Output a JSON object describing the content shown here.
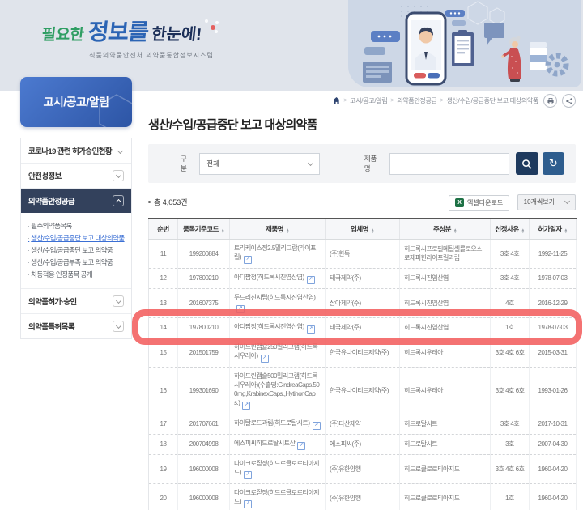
{
  "colors": {
    "accent_blue": "#2d55a5",
    "sidebar_dark": "#33415c",
    "link_blue": "#3b6fd4",
    "highlight_red": "#f35f5f",
    "search_btn_navy": "#1e3a5e",
    "refresh_btn_blue": "#2e5d8e",
    "excel_green": "#1e7145"
  },
  "icons": {
    "home": "home-icon",
    "print": "print-icon",
    "share": "share-icon",
    "search": "magnifier-icon",
    "refresh": "refresh-icon",
    "external_link_glyph": "↗",
    "sort_up_glyph": "▲",
    "sort_down_glyph": "▼",
    "excel_glyph": "X",
    "refresh_glyph": "↻"
  },
  "banner": {
    "logo_p1": "필요한",
    "logo_p2": "정보를",
    "logo_p3": "한눈에!",
    "org_subtitle": "식품의약품안전처 의약품통합정보시스템"
  },
  "sidebar": {
    "title": "고시/공고/알림",
    "item_covid": "코로나19 관련 허가승인현황",
    "item_safety": "안전성정보",
    "item_supply": "의약품안정공급",
    "item_approval": "의약품허가·승인",
    "item_patent": "의약품특허목록",
    "submenu": [
      {
        "label": "필수의약품목록"
      },
      {
        "label": "생산/수입/공급중단 보고 대상의약품"
      },
      {
        "label": "생산/수입/공급중단 보고 의약품"
      },
      {
        "label": "생산/수입/공급부족 보고 의약품"
      },
      {
        "label": "차등적용 인정품목 공개"
      }
    ],
    "active_submenu_index": 1
  },
  "breadcrumb": {
    "items": [
      "고시/공고/알림",
      "의약품안정공급",
      "생산/수입/공급중단 보고 대상의약품"
    ]
  },
  "page": {
    "title": "생산/수입/공급중단 보고 대상의약품"
  },
  "search": {
    "category_label": "구분",
    "category_value": "전체",
    "product_label": "제품명",
    "product_value": ""
  },
  "results": {
    "total_text": "총 4,053건",
    "excel_button": "엑셀다운로드",
    "page_size_button": "10개씩보기"
  },
  "table": {
    "columns": [
      {
        "key": "no",
        "label": "순번",
        "sortable": false
      },
      {
        "key": "code",
        "label": "품목기준코드",
        "sortable": true
      },
      {
        "key": "product",
        "label": "제품명",
        "sortable": true
      },
      {
        "key": "company",
        "label": "업체명",
        "sortable": true
      },
      {
        "key": "ingredient",
        "label": "주성분",
        "sortable": true
      },
      {
        "key": "reason",
        "label": "선정사유",
        "sortable": true
      },
      {
        "key": "date",
        "label": "허가일자",
        "sortable": true
      }
    ],
    "rows": [
      {
        "no": "11",
        "code": "199200884",
        "product": "트리케이스정2.5밀리그람(라이프릴)",
        "company": "(주)한독",
        "ingredient": "히드록시프로필메틸셀룰로오스로제피한라이프릴과립",
        "reason": "3호 4호",
        "date": "1992-11-25"
      },
      {
        "no": "12",
        "code": "197800210",
        "product": "아디팜정(히드록시진염산염)",
        "company": "태극제약(주)",
        "ingredient": "히드록시진염산염",
        "reason": "3호 4호",
        "date": "1978-07-03"
      },
      {
        "no": "13",
        "code": "201607375",
        "product": "두드리진시럽(히드록시진염산염)",
        "company": "삼아제약(주)",
        "ingredient": "히드록시진염산염",
        "reason": "4호",
        "date": "2016-12-29"
      },
      {
        "no": "14",
        "code": "197800210",
        "product": "아디팜정(히드록시진염산염)",
        "company": "태극제약(주)",
        "ingredient": "히드록시진염산염",
        "reason": "1호",
        "date": "1978-07-03"
      },
      {
        "no": "15",
        "code": "201501759",
        "product": "하이드린캡슐250밀리그램(히드록시우레아)",
        "company": "한국유나이티드제약(주)",
        "ingredient": "히드록시우레아",
        "reason": "3호 4호 6호",
        "date": "2015-03-31"
      },
      {
        "no": "16",
        "code": "199301690",
        "product": "하이드린캡슐500밀리그램(히드록시우레아)(수출명:GindreaCaps.500mg,KrabinexCaps.,HytinonCaps.)",
        "company": "한국유나이티드제약(주)",
        "ingredient": "히드록시우레아",
        "reason": "3호 4호 6호",
        "date": "1993-01-26"
      },
      {
        "no": "17",
        "code": "201707661",
        "product": "하이탈로드과립(히드로탈시트)",
        "company": "(주)다산제약",
        "ingredient": "히드로탈시트",
        "reason": "3호 4호",
        "date": "2017-10-31"
      },
      {
        "no": "18",
        "code": "200704998",
        "product": "에스피씨히드로탈시트산",
        "company": "에스피씨(주)",
        "ingredient": "히드로탈시트",
        "reason": "3호",
        "date": "2007-04-30"
      },
      {
        "no": "19",
        "code": "196000008",
        "product": "다이크로짇정(히드로클로로티아지드)",
        "company": "(주)유한양행",
        "ingredient": "히드로클로로티아지드",
        "reason": "3호 4호 6호",
        "date": "1960-04-20"
      },
      {
        "no": "20",
        "code": "196000008",
        "product": "다이크로짇정(히드로클로로티아지드)",
        "company": "(주)유한양행",
        "ingredient": "히드로클로로티아지드",
        "reason": "1호",
        "date": "1960-04-20"
      }
    ],
    "highlight_row_no": "14"
  }
}
